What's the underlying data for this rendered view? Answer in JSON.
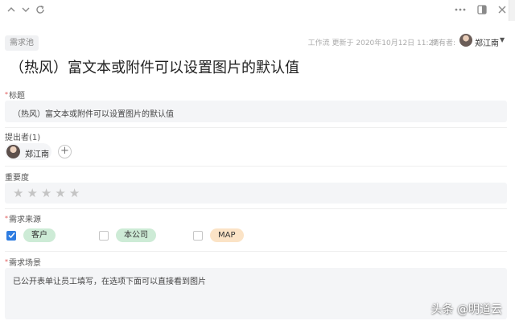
{
  "toolbar": {
    "icons": [
      "chevron-up-icon",
      "chevron-down-icon",
      "refresh-icon",
      "more-icon",
      "panel-toggle-icon",
      "close-icon"
    ]
  },
  "header": {
    "tag": "需求池",
    "meta_text": "工作流 更新于 2020年10月12日 11:27",
    "owner_label": "拥有者:",
    "owner_name": "郑江南"
  },
  "title": "（热风）富文本或附件可以设置图片的默认值",
  "fields": {
    "title_field": {
      "label": "标题",
      "required": true,
      "value": "（热风）富文本或附件可以设置图片的默认值"
    },
    "submitter": {
      "label": "提出者(1)",
      "person": "郑江南"
    },
    "importance": {
      "label": "重要度",
      "stars_total": 5,
      "stars_filled": 0
    },
    "source": {
      "label": "需求来源",
      "required": true,
      "options": [
        {
          "label": "客户",
          "checked": true,
          "bg": "#cdebd6",
          "fg": "#333333"
        },
        {
          "label": "本公司",
          "checked": false,
          "bg": "#cdebd6",
          "fg": "#333333"
        },
        {
          "label": "MAP",
          "checked": false,
          "bg": "#fbe3c6",
          "fg": "#333333"
        }
      ]
    },
    "scenario": {
      "label": "需求场景",
      "required": true,
      "value": "已公开表单让员工填写，在选项下面可以直接看到图片"
    }
  },
  "watermark": "头条 @明道云",
  "colors": {
    "accent": "#2f7de1",
    "required": "#e05a5a",
    "field_bg": "#f4f5f7"
  }
}
